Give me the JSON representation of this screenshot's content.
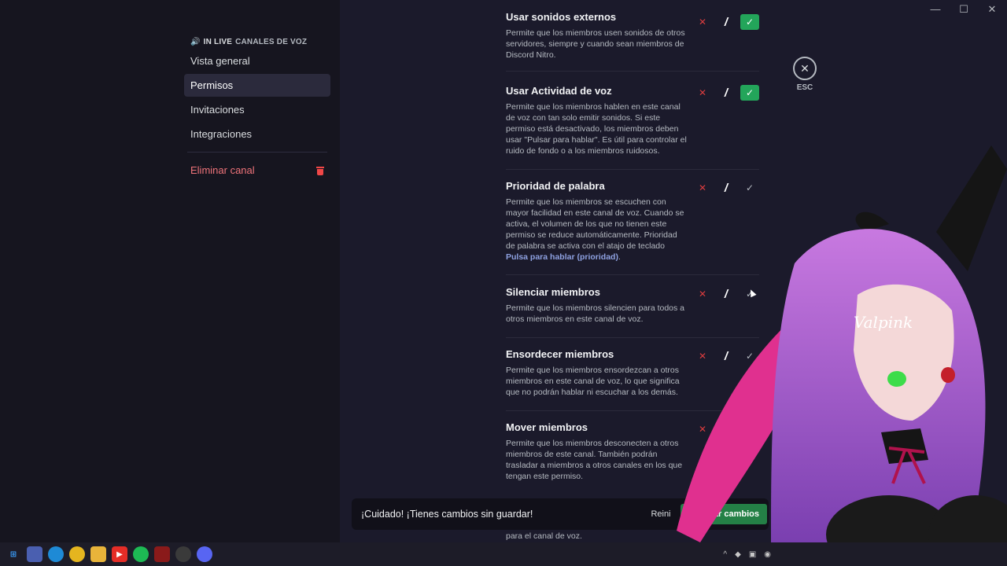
{
  "window": {
    "minimize": "—",
    "maximize": "☐",
    "close": "✕"
  },
  "sidebar": {
    "header_live": "IN LIVE",
    "header_section": "CANALES DE VOZ",
    "items": [
      {
        "label": "Vista general",
        "active": false
      },
      {
        "label": "Permisos",
        "active": true
      },
      {
        "label": "Invitaciones",
        "active": false
      },
      {
        "label": "Integraciones",
        "active": false
      }
    ],
    "danger_label": "Eliminar canal"
  },
  "permissions": [
    {
      "title": "Usar sonidos externos",
      "desc": "Permite que los miembros usen sonidos de otros servidores, siempre y cuando sean miembros de Discord Nitro.",
      "state": "allow"
    },
    {
      "title": "Usar Actividad de voz",
      "desc": "Permite que los miembros hablen en este canal de voz con tan solo emitir sonidos. Si este permiso está desactivado, los miembros deben usar \"Pulsar para hablar\". Es útil para controlar el ruido de fondo o a los miembros ruidosos.",
      "state": "allow"
    },
    {
      "title": "Prioridad de palabra",
      "desc": "Permite que los miembros se escuchen con mayor facilidad en este canal de voz. Cuando se activa, el volumen de los que no tienen este permiso se reduce automáticamente. Prioridad de palabra se activa con el atajo de teclado",
      "link": "Pulsa para hablar (prioridad)",
      "state": "neutral"
    },
    {
      "title": "Silenciar miembros",
      "desc": "Permite que los miembros silencien para todos a otros miembros en este canal de voz.",
      "state": "neutral"
    },
    {
      "title": "Ensordecer miembros",
      "desc": "Permite que los miembros ensordezcan a otros miembros en este canal de voz, lo que significa que no podrán hablar ni escuchar a los demás.",
      "state": "neutral"
    },
    {
      "title": "Mover miembros",
      "desc": "Permite que los miembros desconecten a otros miembros de este canal. También podrán trasladar a miembros a otros canales en los que tengan este permiso.",
      "state": "neutral"
    }
  ],
  "toggle_glyphs": {
    "deny": "✕",
    "neutral": "/",
    "allow": "✓"
  },
  "esc": {
    "icon": "✕",
    "label": "ESC"
  },
  "savebar": {
    "warning": "¡Cuidado! ¡Tienes cambios sin guardar!",
    "reset": "Reini",
    "save": "Guardar cambios"
  },
  "below_text": "para el canal de voz.",
  "avatar_watermark": "Valpink",
  "taskbar": {
    "icons": [
      "windows-start-icon",
      "app-icon",
      "edge-icon",
      "chrome-icon",
      "files-icon",
      "youtube-icon",
      "spotify-icon",
      "app2-icon",
      "clock-app-icon",
      "discord-icon"
    ],
    "tray": [
      "^",
      "◆",
      "▣",
      "◉"
    ]
  },
  "colors": {
    "allow": "#23a55a",
    "deny": "#d83c3e",
    "danger": "#f0747a",
    "link": "#8ea1e1",
    "save": "#248046"
  }
}
